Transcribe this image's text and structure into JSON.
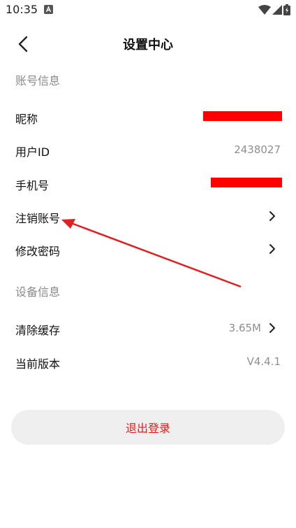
{
  "status_bar": {
    "time": "10:35",
    "icons": [
      "a-notification-icon",
      "wifi-icon",
      "signal-icon",
      "battery-icon"
    ]
  },
  "header": {
    "back_icon": "chevron-left-icon",
    "title": "设置中心"
  },
  "account_section": {
    "label": "账号信息",
    "rows": [
      {
        "label": "昵称",
        "value": ""
      },
      {
        "label": "用户ID",
        "value": "2438027"
      },
      {
        "label": "手机号",
        "value": ""
      },
      {
        "label": "注销账号",
        "value": ""
      },
      {
        "label": "修改密码",
        "value": ""
      }
    ]
  },
  "device_section": {
    "label": "设备信息",
    "rows": [
      {
        "label": "清除缓存",
        "value": "3.65M"
      },
      {
        "label": "当前版本",
        "value": "V4.4.1"
      }
    ]
  },
  "logout": {
    "label": "退出登录"
  },
  "colors": {
    "accent": "#e81a1a",
    "redaction": "#ff0000",
    "annotation_arrow": "#e02020",
    "muted_text": "#8a8a8a",
    "button_bg": "#efefef"
  }
}
